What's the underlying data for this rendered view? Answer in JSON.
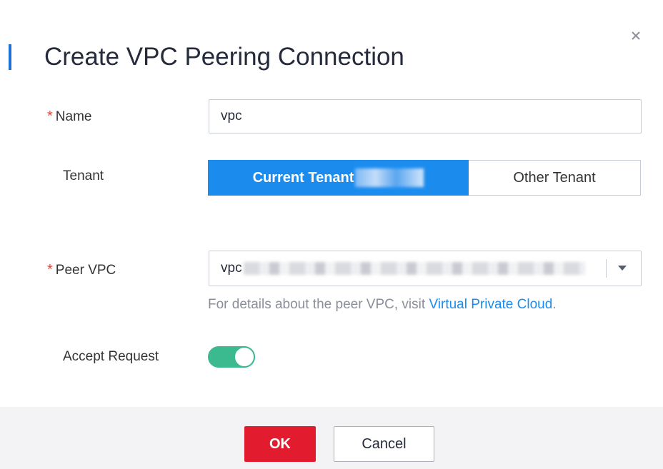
{
  "dialog": {
    "title": "Create VPC Peering Connection",
    "accent_color": "#1b8cee"
  },
  "form": {
    "name": {
      "label": "Name",
      "required": true,
      "value": "vpc",
      "placeholder": ""
    },
    "tenant": {
      "label": "Tenant",
      "options": [
        "Current Tenant",
        "Other Tenant"
      ],
      "selected": "Current Tenant"
    },
    "peer_vpc": {
      "label": "Peer VPC",
      "required": true,
      "value": "vpc",
      "hint_text": "For details about the peer VPC, visit ",
      "hint_link": "Virtual Private Cloud",
      "hint_end": "."
    },
    "accept_request": {
      "label": "Accept Request",
      "enabled": true,
      "color": "#3cba8f"
    }
  },
  "footer": {
    "ok_label": "OK",
    "cancel_label": "Cancel",
    "ok_color": "#e31b2f"
  },
  "icons": {
    "close": "close-icon",
    "dropdown": "chevron-down-icon"
  }
}
